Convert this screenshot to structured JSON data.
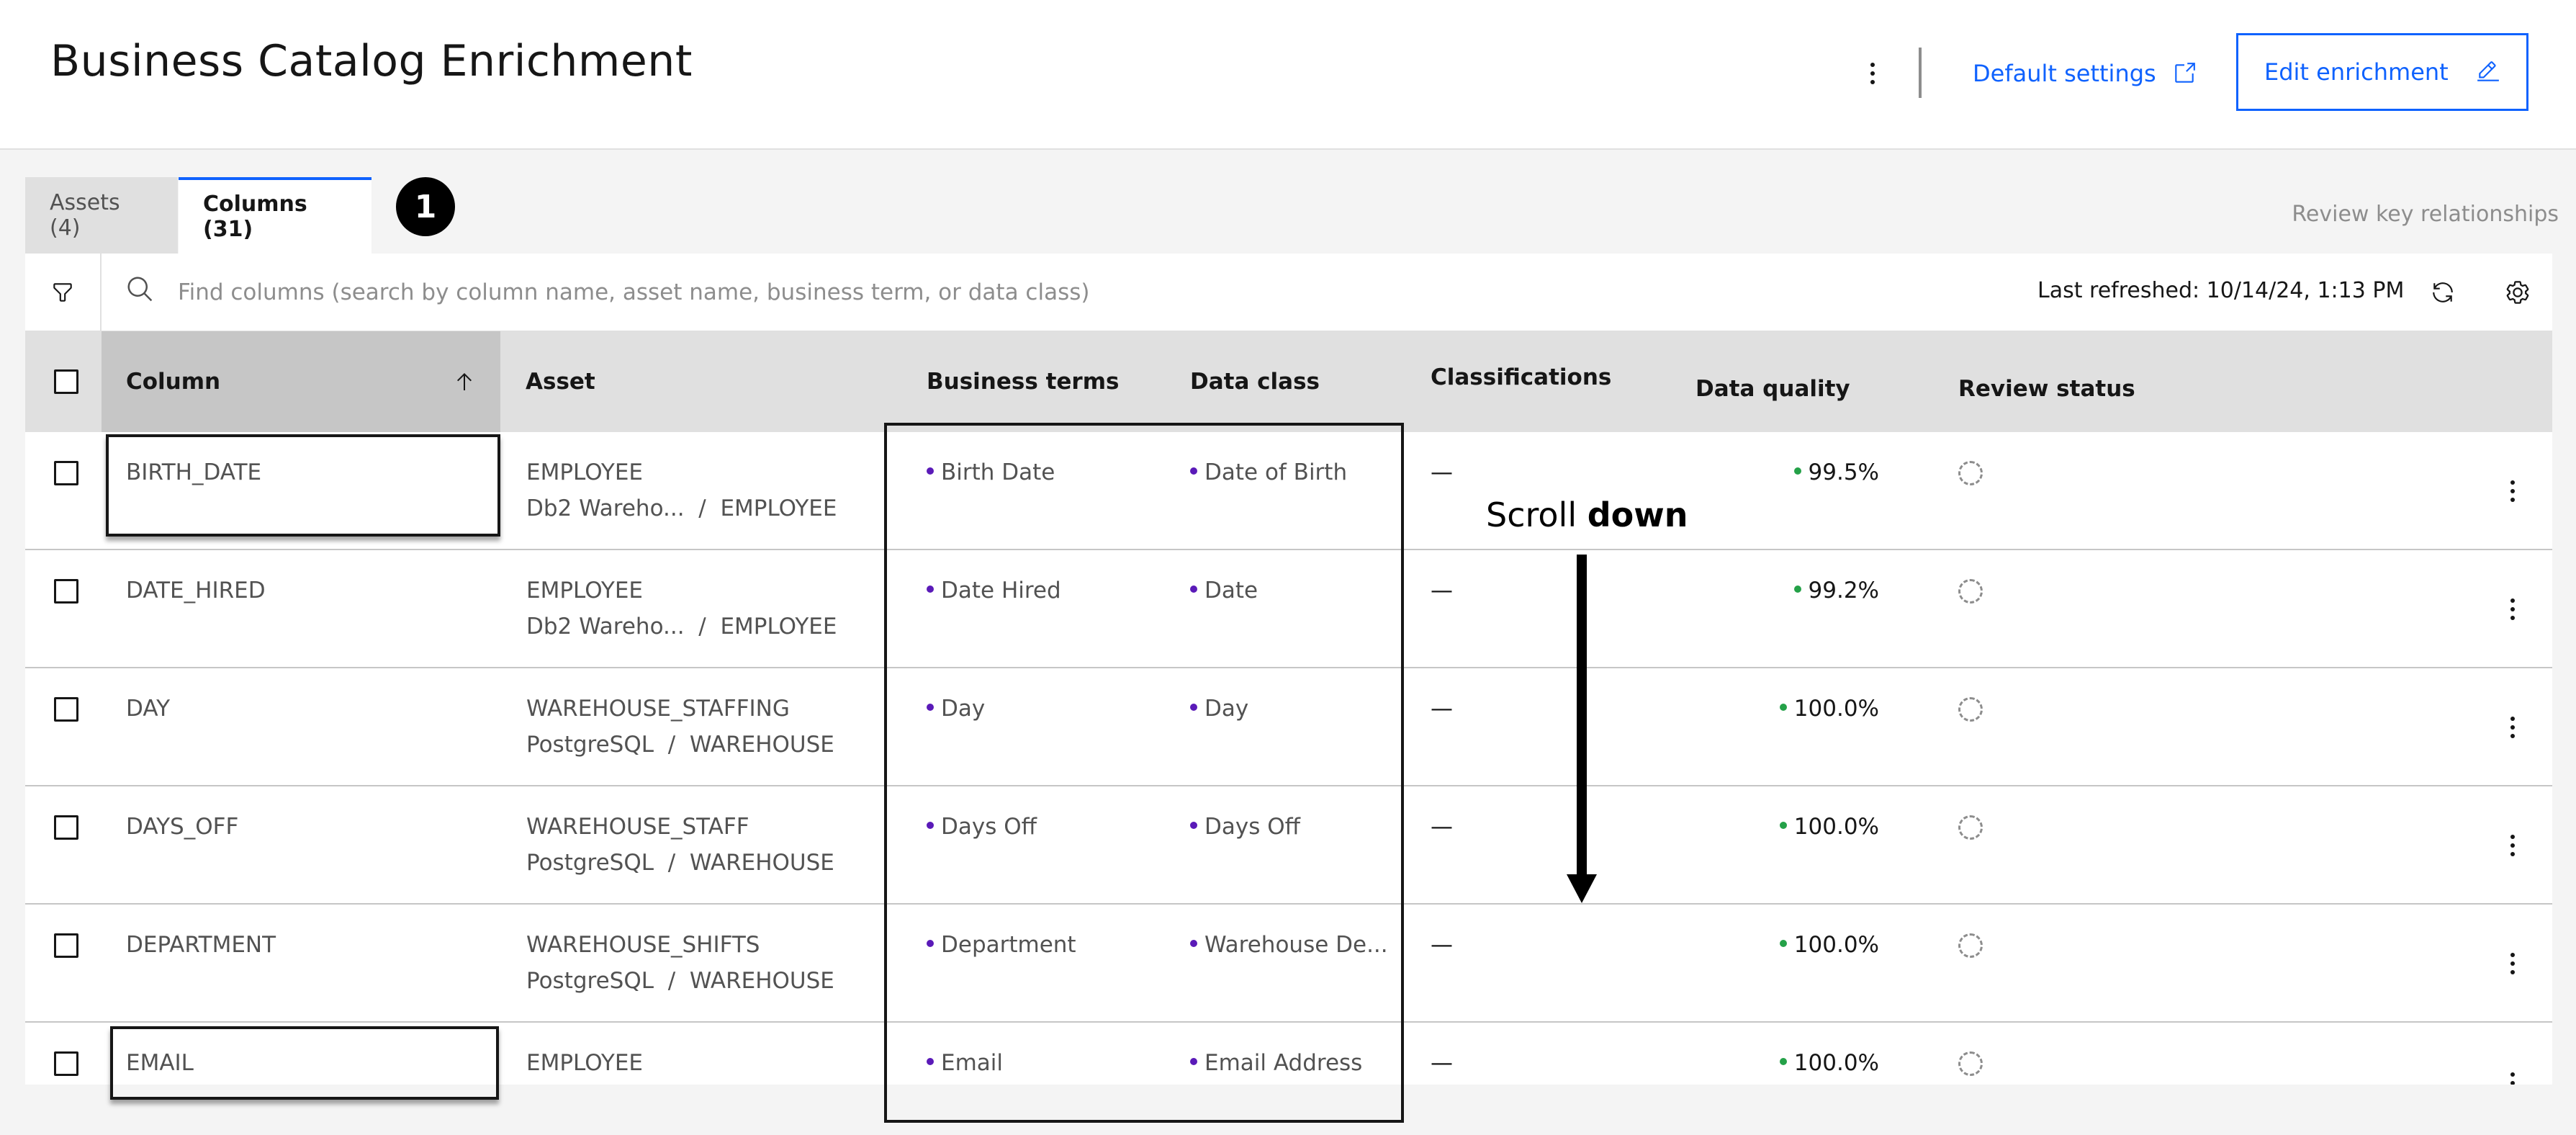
{
  "header": {
    "title": "Business Catalog Enrichment",
    "default_settings_label": "Default settings",
    "edit_enrichment_label": "Edit enrichment"
  },
  "tabs": [
    {
      "label": "Assets (4)",
      "selected": false
    },
    {
      "label": "Columns (31)",
      "selected": true
    }
  ],
  "step_badge": "1",
  "review_key_relationships": "Review key relationships",
  "toolbar": {
    "search_placeholder": "Find columns (search by column name, asset name, business term, or data class)",
    "last_refreshed": "Last refreshed: 10/14/24, 1:13 PM"
  },
  "table": {
    "headers": {
      "column": "Column",
      "asset": "Asset",
      "business_terms": "Business terms",
      "data_class": "Data class",
      "classifications": "Classifications",
      "data_quality": "Data quality",
      "review_status": "Review status"
    },
    "rows": [
      {
        "column": "BIRTH_DATE",
        "asset_name": "EMPLOYEE",
        "asset_source": "Db2 Wareho...",
        "asset_schema": "EMPLOYEE",
        "business_term": "Birth Date",
        "data_class": "Date of Birth",
        "classifications": "—",
        "data_quality": "99.5%"
      },
      {
        "column": "DATE_HIRED",
        "asset_name": "EMPLOYEE",
        "asset_source": "Db2 Wareho...",
        "asset_schema": "EMPLOYEE",
        "business_term": "Date Hired",
        "data_class": "Date",
        "classifications": "—",
        "data_quality": "99.2%"
      },
      {
        "column": "DAY",
        "asset_name": "WAREHOUSE_STAFFING",
        "asset_source": "PostgreSQL",
        "asset_schema": "WAREHOUSE",
        "business_term": "Day",
        "data_class": "Day",
        "classifications": "—",
        "data_quality": "100.0%"
      },
      {
        "column": "DAYS_OFF",
        "asset_name": "WAREHOUSE_STAFF",
        "asset_source": "PostgreSQL",
        "asset_schema": "WAREHOUSE",
        "business_term": "Days Off",
        "data_class": "Days Off",
        "classifications": "—",
        "data_quality": "100.0%"
      },
      {
        "column": "DEPARTMENT",
        "asset_name": "WAREHOUSE_SHIFTS",
        "asset_source": "PostgreSQL",
        "asset_schema": "WAREHOUSE",
        "business_term": "Department",
        "data_class": "Warehouse De...",
        "classifications": "—",
        "data_quality": "100.0%"
      },
      {
        "column": "EMAIL",
        "asset_name": "EMPLOYEE",
        "asset_source": "",
        "asset_schema": "",
        "business_term": "Email",
        "data_class": "Email Address",
        "classifications": "—",
        "data_quality": "100.0%"
      }
    ]
  },
  "annotation": {
    "scroll_prefix": "Scroll ",
    "scroll_bold": "down"
  },
  "colors": {
    "accent": "#0f62fe",
    "term_dot": "#5a1ab8",
    "quality_dot": "#24a148"
  }
}
